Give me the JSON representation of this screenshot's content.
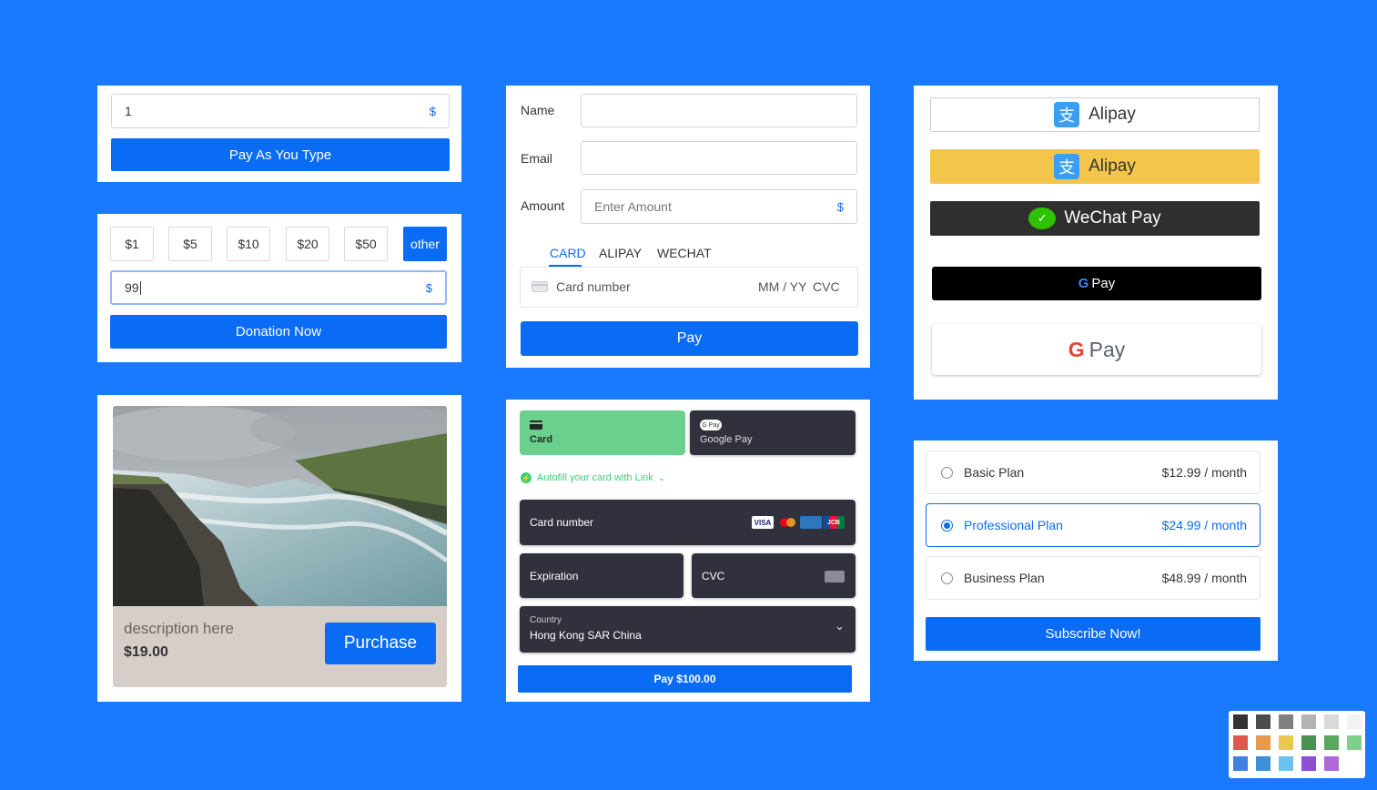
{
  "pay_as_you_type": {
    "amount": "1",
    "currency": "$",
    "button_label": "Pay As You Type"
  },
  "donation": {
    "amounts": [
      "$1",
      "$5",
      "$10",
      "$20",
      "$50",
      "other"
    ],
    "custom_value": "99",
    "currency": "$",
    "button_label": "Donation Now"
  },
  "product": {
    "description": "description here",
    "price": "$19.00",
    "button_label": "Purchase"
  },
  "checkout_form": {
    "name_label": "Name",
    "email_label": "Email",
    "amount_label": "Amount",
    "amount_placeholder": "Enter Amount",
    "currency": "$",
    "tabs": [
      "CARD",
      "ALIPAY",
      "WECHAT"
    ],
    "card_number_placeholder": "Card number",
    "expiry_placeholder": "MM / YY",
    "cvc_placeholder": "CVC",
    "pay_label": "Pay"
  },
  "stripe_element": {
    "methods": [
      {
        "label": "Card",
        "icon": "card-icon"
      },
      {
        "label": "Google Pay",
        "icon": "gpay-icon"
      }
    ],
    "autofill_label": "Autofill your card with Link",
    "card_number_label": "Card number",
    "card_brands": [
      "VISA",
      "mastercard",
      "amex",
      "JCB"
    ],
    "expiration_label": "Expiration",
    "cvc_label": "CVC",
    "country_label": "Country",
    "country_value": "Hong Kong SAR China",
    "pay_label": "Pay $100.00"
  },
  "wallets": {
    "alipay_outline_label": "Alipay",
    "alipay_yellow_label": "Alipay",
    "wechat_label": "WeChat Pay",
    "gpay_black_label": "Pay",
    "gpay_white_label": "Pay"
  },
  "subscription": {
    "plans": [
      {
        "name": "Basic Plan",
        "price": "$12.99 / month",
        "selected": false
      },
      {
        "name": "Professional Plan",
        "price": "$24.99 / month",
        "selected": true
      },
      {
        "name": "Business Plan",
        "price": "$48.99 / month",
        "selected": false
      }
    ],
    "button_label": "Subscribe Now!"
  },
  "colors": {
    "background": "#1a7aff",
    "primary": "#0a6cf5",
    "stripe_dark": "#30313d",
    "stripe_green": "#6bd08e",
    "alipay_yellow": "#f3c54b",
    "wechat_dark": "#2f2f2f",
    "product_footer": "#d8cec9"
  },
  "palette": [
    "#333333",
    "#4d4d4d",
    "#808080",
    "#b3b3b3",
    "#d9d9d9",
    "#f2f2f2",
    "#e0574f",
    "#e89a4a",
    "#e8c84f",
    "#4a9050",
    "#5aa85e",
    "#7fd08c",
    "#3f80e0",
    "#3f8fd6",
    "#6cc3f0",
    "#8b4fd6",
    "#b06ad8"
  ]
}
